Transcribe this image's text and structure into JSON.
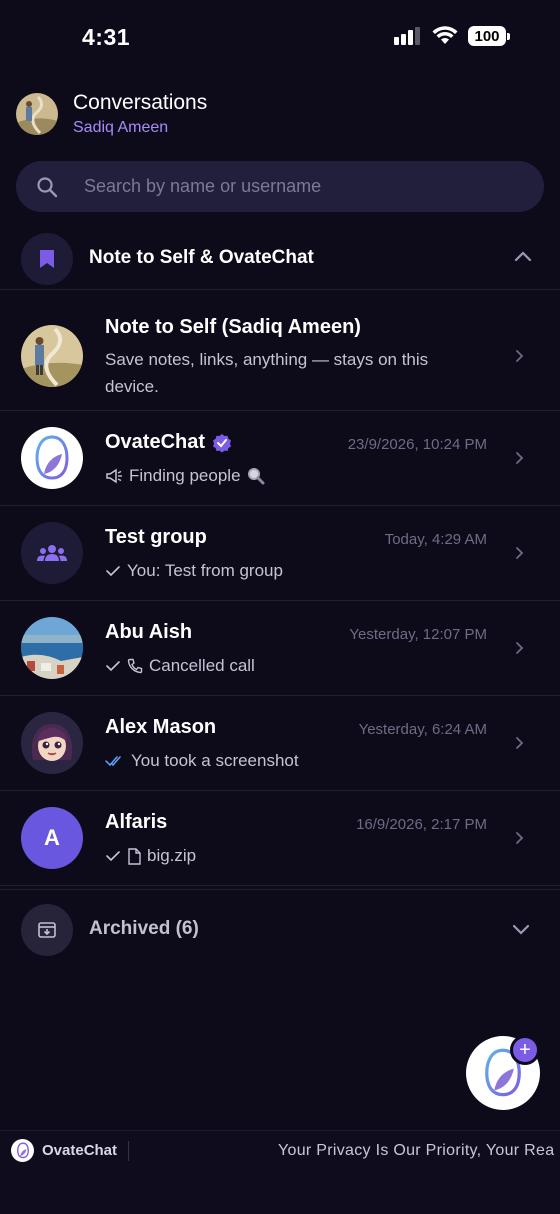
{
  "status_bar": {
    "time": "4:31",
    "battery": "100"
  },
  "header": {
    "title": "Conversations",
    "subtitle": "Sadiq Ameen"
  },
  "search": {
    "placeholder": "Search by name or username",
    "value": ""
  },
  "section": {
    "title": "Note to Self & OvateChat"
  },
  "conversations": [
    {
      "name": "Note to Self (Sadiq Ameen)",
      "time": "",
      "preview": "Save notes, links, anything — stays on this device."
    },
    {
      "name": "OvateChat",
      "time": "23/9/2026, 10:24 PM",
      "preview": "Finding people"
    },
    {
      "name": "Test group",
      "time": "Today, 4:29 AM",
      "preview": "You: Test from group"
    },
    {
      "name": "Abu Aish",
      "time": "Yesterday, 12:07 PM",
      "preview": "Cancelled call"
    },
    {
      "name": "Alex Mason",
      "time": "Yesterday, 6:24 AM",
      "preview": "You took a screenshot"
    },
    {
      "name": "Alfaris",
      "time": "16/9/2026, 2:17 PM",
      "preview": "big.zip",
      "initial": "A"
    }
  ],
  "archived": {
    "label": "Archived (6)"
  },
  "fab": {
    "plus": "+"
  },
  "footer": {
    "brand": "OvateChat",
    "marquee": "Your Privacy Is Our Priority, Your Rea"
  },
  "colors": {
    "accent": "#a78bfa",
    "fab_badge": "#7c5ce6",
    "background": "#0d0b1a",
    "verified": "#7c5ce6",
    "read_ticks": "#60a5fa"
  }
}
